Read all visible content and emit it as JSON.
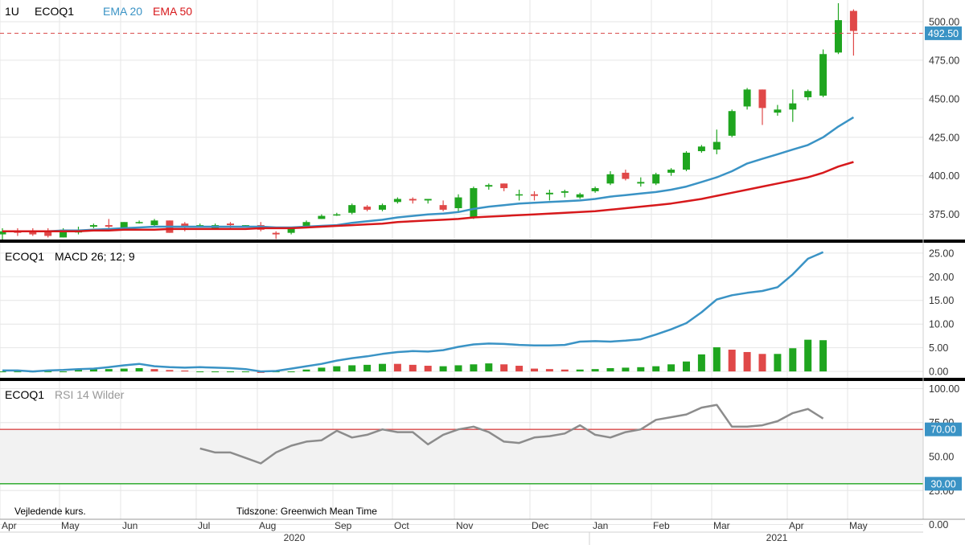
{
  "chart_data": [
    {
      "type": "candlestick",
      "interval": "1U",
      "symbol": "ECOQ1",
      "overlays": [
        {
          "name": "EMA 20",
          "color": "#3a93c5"
        },
        {
          "name": "EMA 50",
          "color": "#d7191c"
        }
      ],
      "ylim": [
        355,
        512
      ],
      "yticks": [
        "500.00",
        "475.00",
        "450.00",
        "425.00",
        "400.00",
        "375.00"
      ],
      "last_price": {
        "value": 492.5,
        "label": "492.50",
        "color": "#d94a4a"
      },
      "candles": [
        {
          "o": 362,
          "h": 366,
          "l": 358,
          "c": 364
        },
        {
          "o": 364,
          "h": 366,
          "l": 361,
          "c": 363
        },
        {
          "o": 364,
          "h": 366,
          "l": 361,
          "c": 362
        },
        {
          "o": 364,
          "h": 366,
          "l": 360,
          "c": 361
        },
        {
          "o": 360,
          "h": 366,
          "l": 360,
          "c": 365
        },
        {
          "o": 364,
          "h": 367,
          "l": 362,
          "c": 364
        },
        {
          "o": 367,
          "h": 369,
          "l": 366,
          "c": 368
        },
        {
          "o": 368,
          "h": 372,
          "l": 366,
          "c": 367
        },
        {
          "o": 366,
          "h": 370,
          "l": 365,
          "c": 370
        },
        {
          "o": 370,
          "h": 371,
          "l": 369,
          "c": 370
        },
        {
          "o": 368,
          "h": 372,
          "l": 367,
          "c": 371
        },
        {
          "o": 371,
          "h": 371,
          "l": 363,
          "c": 363
        },
        {
          "o": 369,
          "h": 370,
          "l": 364,
          "c": 367
        },
        {
          "o": 368,
          "h": 369,
          "l": 367,
          "c": 368
        },
        {
          "o": 366,
          "h": 369,
          "l": 366,
          "c": 368
        },
        {
          "o": 369,
          "h": 370,
          "l": 366,
          "c": 368
        },
        {
          "o": 368,
          "h": 368,
          "l": 367,
          "c": 368
        },
        {
          "o": 368,
          "h": 370,
          "l": 364,
          "c": 365
        },
        {
          "o": 363,
          "h": 364,
          "l": 359,
          "c": 362
        },
        {
          "o": 363,
          "h": 366,
          "l": 362,
          "c": 366
        },
        {
          "o": 367,
          "h": 371,
          "l": 366,
          "c": 370
        },
        {
          "o": 372,
          "h": 375,
          "l": 372,
          "c": 374
        },
        {
          "o": 375,
          "h": 376,
          "l": 374,
          "c": 375
        },
        {
          "o": 376,
          "h": 382,
          "l": 375,
          "c": 381
        },
        {
          "o": 380,
          "h": 381,
          "l": 377,
          "c": 378
        },
        {
          "o": 378,
          "h": 382,
          "l": 377,
          "c": 381
        },
        {
          "o": 383,
          "h": 386,
          "l": 382,
          "c": 385
        },
        {
          "o": 385,
          "h": 386,
          "l": 382,
          "c": 384
        },
        {
          "o": 384,
          "h": 385,
          "l": 382,
          "c": 385
        },
        {
          "o": 381,
          "h": 384,
          "l": 377,
          "c": 378
        },
        {
          "o": 379,
          "h": 388,
          "l": 377,
          "c": 386
        },
        {
          "o": 373,
          "h": 393,
          "l": 372,
          "c": 392
        },
        {
          "o": 393,
          "h": 395,
          "l": 391,
          "c": 394
        },
        {
          "o": 395,
          "h": 395,
          "l": 390,
          "c": 392
        },
        {
          "o": 388,
          "h": 391,
          "l": 384,
          "c": 388
        },
        {
          "o": 388,
          "h": 390,
          "l": 384,
          "c": 387
        },
        {
          "o": 388,
          "h": 391,
          "l": 384,
          "c": 389
        },
        {
          "o": 389,
          "h": 391,
          "l": 386,
          "c": 390
        },
        {
          "o": 386,
          "h": 389,
          "l": 385,
          "c": 388
        },
        {
          "o": 390,
          "h": 393,
          "l": 389,
          "c": 392
        },
        {
          "o": 395,
          "h": 403,
          "l": 394,
          "c": 401
        },
        {
          "o": 402,
          "h": 404,
          "l": 397,
          "c": 398
        },
        {
          "o": 395,
          "h": 399,
          "l": 393,
          "c": 396
        },
        {
          "o": 395,
          "h": 402,
          "l": 394,
          "c": 401
        },
        {
          "o": 402,
          "h": 405,
          "l": 400,
          "c": 404
        },
        {
          "o": 404,
          "h": 416,
          "l": 403,
          "c": 415
        },
        {
          "o": 416,
          "h": 420,
          "l": 415,
          "c": 419
        },
        {
          "o": 417,
          "h": 430,
          "l": 414,
          "c": 422
        },
        {
          "o": 426,
          "h": 443,
          "l": 425,
          "c": 442
        },
        {
          "o": 445,
          "h": 457,
          "l": 443,
          "c": 456
        },
        {
          "o": 456,
          "h": 456,
          "l": 433,
          "c": 444
        },
        {
          "o": 441,
          "h": 446,
          "l": 439,
          "c": 443
        },
        {
          "o": 443,
          "h": 456,
          "l": 435,
          "c": 447
        },
        {
          "o": 451,
          "h": 456,
          "l": 449,
          "c": 455
        },
        {
          "o": 452,
          "h": 482,
          "l": 451,
          "c": 479
        },
        {
          "o": 480,
          "h": 512,
          "l": 479,
          "c": 501
        },
        {
          "o": 507,
          "h": 508,
          "l": 478,
          "c": 494
        }
      ],
      "ema20": [
        364,
        364,
        364,
        364,
        364.5,
        364.5,
        365,
        365.5,
        366,
        366.5,
        367,
        367,
        367,
        367,
        367,
        367,
        367,
        367,
        366.5,
        366.5,
        367,
        367.5,
        368,
        369.5,
        370.5,
        371.5,
        373,
        374,
        375,
        375.5,
        376.5,
        378.5,
        380,
        381,
        382,
        382.5,
        383,
        383.5,
        384,
        385,
        386.5,
        387.5,
        388.5,
        389.5,
        391,
        393,
        396,
        399,
        403,
        408,
        411,
        414,
        417,
        420,
        425,
        432,
        438
      ],
      "ema50": [
        364,
        364,
        364,
        364,
        364,
        364,
        364.5,
        364.5,
        365,
        365,
        365,
        365.5,
        365.5,
        365.5,
        365.5,
        365.5,
        365.5,
        366,
        366,
        366,
        366.5,
        367,
        367.5,
        368,
        368.5,
        369,
        370,
        370.5,
        371,
        371.5,
        372,
        373,
        373.5,
        374,
        374.5,
        375,
        375.5,
        376,
        376.5,
        377,
        378,
        379,
        380,
        381,
        382,
        383.5,
        385,
        387,
        389,
        391,
        393,
        395,
        397,
        399,
        402,
        406,
        409
      ]
    },
    {
      "type": "bar+line",
      "symbol": "ECOQ1",
      "indicator": "MACD 26; 12; 9",
      "ylim": [
        -1,
        26.5
      ],
      "yticks": [
        "25.00",
        "20.00",
        "15.00",
        "10.00",
        "5.00",
        "0.00"
      ],
      "macd": [
        0.2,
        0.2,
        0,
        0.2,
        0.3,
        0.5,
        0.6,
        0.9,
        1.3,
        1.6,
        1.1,
        0.9,
        0.8,
        0.9,
        0.8,
        0.7,
        0.5,
        0,
        0.1,
        0.6,
        1.1,
        1.6,
        2.3,
        2.8,
        3.2,
        3.7,
        4.1,
        4.3,
        4.2,
        4.5,
        5.2,
        5.7,
        5.9,
        5.8,
        5.6,
        5.5,
        5.5,
        5.6,
        6.3,
        6.4,
        6.3,
        6.5,
        6.8,
        7.8,
        8.9,
        10.2,
        12.5,
        15.2,
        16.1,
        16.6,
        17.0,
        17.8,
        20.5,
        23.8,
        25.2
      ],
      "histogram": [
        0,
        0,
        0,
        0,
        0,
        0.4,
        0.5,
        0.5,
        0.6,
        0.7,
        0.5,
        0.3,
        0.2,
        0,
        0,
        0,
        0,
        -0.3,
        0,
        0,
        0.4,
        0.8,
        1.1,
        1.3,
        1.4,
        1.6,
        1.6,
        1.4,
        1.2,
        1.1,
        1.3,
        1.5,
        1.7,
        1.5,
        1.2,
        0.6,
        0.5,
        0.4,
        0.4,
        0.5,
        0.7,
        0.8,
        0.9,
        1.1,
        1.5,
        2.1,
        3.6,
        5.1,
        4.6,
        4.1,
        3.7,
        3.7,
        4.9,
        6.7,
        6.6
      ],
      "hist_colors": [
        "g",
        "g",
        "g",
        "g",
        "g",
        "g",
        "g",
        "g",
        "g",
        "g",
        "r",
        "r",
        "r",
        "g",
        "g",
        "g",
        "g",
        "r",
        "g",
        "g",
        "g",
        "g",
        "g",
        "g",
        "g",
        "g",
        "r",
        "r",
        "r",
        "g",
        "g",
        "g",
        "g",
        "r",
        "r",
        "r",
        "r",
        "r",
        "g",
        "g",
        "g",
        "g",
        "g",
        "g",
        "g",
        "g",
        "g",
        "g",
        "r",
        "r",
        "r",
        "g",
        "g",
        "g",
        "g"
      ]
    },
    {
      "type": "line",
      "symbol": "ECOQ1",
      "indicator": "RSI 14 Wilder",
      "ylim": [
        -5,
        105
      ],
      "yticks": [
        "100.00",
        "75.00",
        "50.00",
        "25.00",
        "0.00"
      ],
      "levels": [
        {
          "value": 70,
          "label": "70.00",
          "color": "#d94a4a"
        },
        {
          "value": 30,
          "label": "30.00",
          "color": "#1fa51f"
        }
      ],
      "rsi_start_index": 13,
      "rsi": [
        56,
        53,
        53,
        49,
        45,
        53,
        58,
        61,
        62,
        69,
        64,
        66,
        70,
        68,
        68,
        59,
        66,
        70,
        72,
        68,
        61,
        60,
        64,
        65,
        67,
        73,
        66,
        64,
        68,
        70,
        77,
        79,
        81,
        86,
        88,
        72,
        72,
        73,
        76,
        82,
        85,
        78
      ]
    }
  ],
  "footer": {
    "source_note": "Vejledende kurs.",
    "timezone": "Tidszone: Greenwich Mean Time",
    "months": [
      "Apr",
      "May",
      "Jun",
      "Jul",
      "Aug",
      "Sep",
      "Oct",
      "Nov",
      "Dec",
      "Jan",
      "Feb",
      "Mar",
      "Apr",
      "May"
    ],
    "years": [
      "2020",
      "2021"
    ]
  },
  "colors": {
    "up": "#1fa51f",
    "down": "#e04848",
    "macd_line": "#3a93c5",
    "rsi_line": "#8c8c8c",
    "axis_text": "#333333",
    "grid": "#e6e6e6",
    "rsi_band": "#f2f2f2"
  }
}
